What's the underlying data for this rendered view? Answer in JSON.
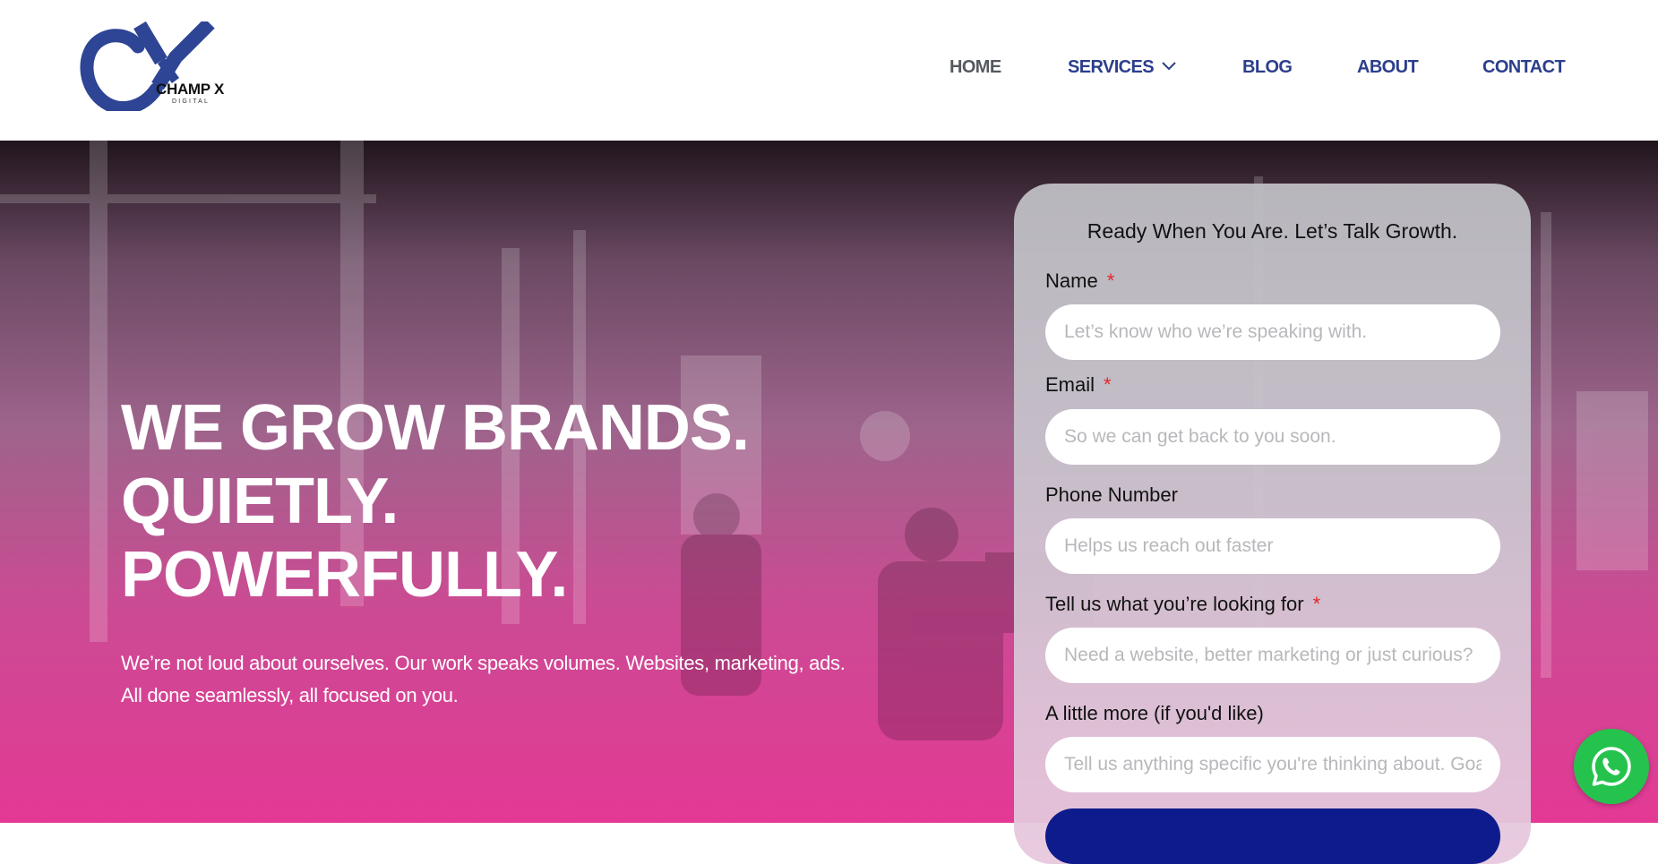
{
  "brand": {
    "name": "CHAMP X",
    "tagline": "DIGITAL",
    "primary_color": "#2c3e8c"
  },
  "nav": {
    "items": [
      {
        "label": "HOME"
      },
      {
        "label": "SERVICES"
      },
      {
        "label": "BLOG"
      },
      {
        "label": "ABOUT"
      },
      {
        "label": "CONTACT"
      }
    ],
    "dropdown_icon": "chevron-down-icon"
  },
  "hero": {
    "title_lines": [
      "WE GROW BRANDS.",
      "QUIETLY.",
      "POWERFULLY."
    ],
    "subtitle_lines": [
      "We’re not loud about ourselves. Our work speaks volumes. Websites, marketing, ads.",
      "All done seamlessly, all focused on you."
    ],
    "gradient_colors": [
      "#140810",
      "#e1288c"
    ]
  },
  "form": {
    "title": "Ready When You Are. Let’s Talk Growth.",
    "required_marker": "*",
    "fields": [
      {
        "label": "Name",
        "placeholder": "Let’s know who we’re speaking with."
      },
      {
        "label": "Email",
        "placeholder": "So we can get back to you soon."
      },
      {
        "label": "Phone Number",
        "placeholder": "Helps us reach out faster"
      },
      {
        "label": "Tell us what you’re looking for",
        "placeholder": "Need a website, better marketing or just curious?"
      },
      {
        "label": "A little more (if you'd like)",
        "placeholder": "Tell us anything specific you're thinking about. Goals, ideas, questions."
      }
    ],
    "submit_color": "#0e1b8c"
  },
  "whatsapp": {
    "icon": "whatsapp-icon",
    "color": "#25c34d"
  }
}
